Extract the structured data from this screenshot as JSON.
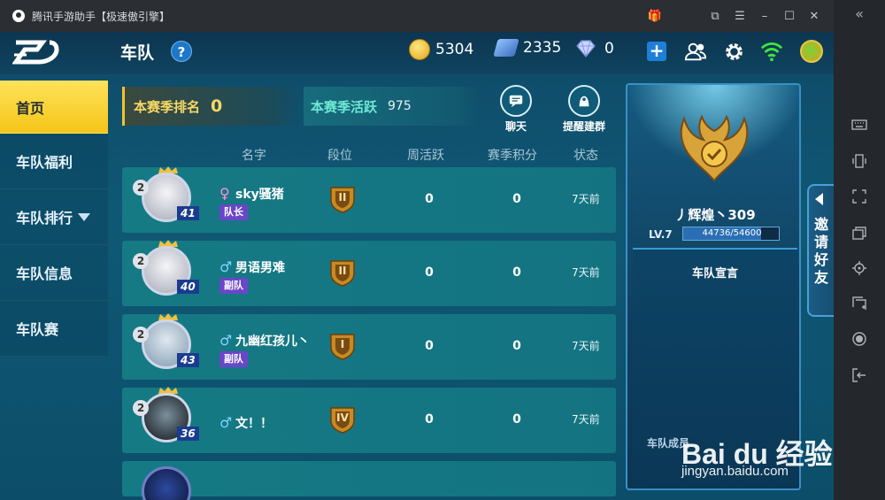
{
  "window": {
    "title": "腾讯手游助手【极速傲引擎】"
  },
  "header": {
    "page_title": "车队",
    "help_label": "?",
    "coins": "5304",
    "cards": "2335",
    "diamonds": "0",
    "add_label": "+"
  },
  "nav": {
    "items": [
      {
        "label": "首页"
      },
      {
        "label": "车队福利"
      },
      {
        "label": "车队排行"
      },
      {
        "label": "车队信息"
      },
      {
        "label": "车队赛"
      }
    ]
  },
  "stats": {
    "rank_label": "本赛季排名",
    "rank_value": "0",
    "activity_label": "本赛季活跃",
    "activity_value": "975"
  },
  "actions": {
    "chat_label": "聊天",
    "remind_label": "提醒建群"
  },
  "table": {
    "headers": [
      "名字",
      "段位",
      "周活跃",
      "赛季积分",
      "状态"
    ],
    "rows": [
      {
        "gender": "♀",
        "name": "sky骚猪",
        "role": "队长",
        "level": "41",
        "badge": "2",
        "tier": "II",
        "weekly": "0",
        "season": "0",
        "status": "7天前"
      },
      {
        "gender": "♂",
        "name": "男语男难",
        "role": "副队",
        "level": "40",
        "badge": "2",
        "tier": "II",
        "weekly": "0",
        "season": "0",
        "status": "7天前"
      },
      {
        "gender": "♂",
        "name": "九幽红孩儿丶",
        "role": "副队",
        "level": "43",
        "badge": "2",
        "tier": "I",
        "weekly": "0",
        "season": "0",
        "status": "7天前"
      },
      {
        "gender": "♂",
        "name": "文！！",
        "role": "",
        "level": "36",
        "badge": "2",
        "tier": "IV",
        "weekly": "0",
        "season": "0",
        "status": "7天前"
      }
    ]
  },
  "team_panel": {
    "team_name": "丿辉煌丶309",
    "level": "LV.7",
    "exp": "44736/54600",
    "exp_fraction": 0.819,
    "manifesto_title": "车队宣言",
    "members_label": "车队成员"
  },
  "invite": {
    "label": "邀请好友"
  },
  "watermark": {
    "brand": "Bai du 经验",
    "url": "jingyan.baidu.com"
  },
  "colors": {
    "accent_yellow": "#f5c518",
    "row_teal": "#157a84",
    "role_purple": "#6a46c8"
  }
}
